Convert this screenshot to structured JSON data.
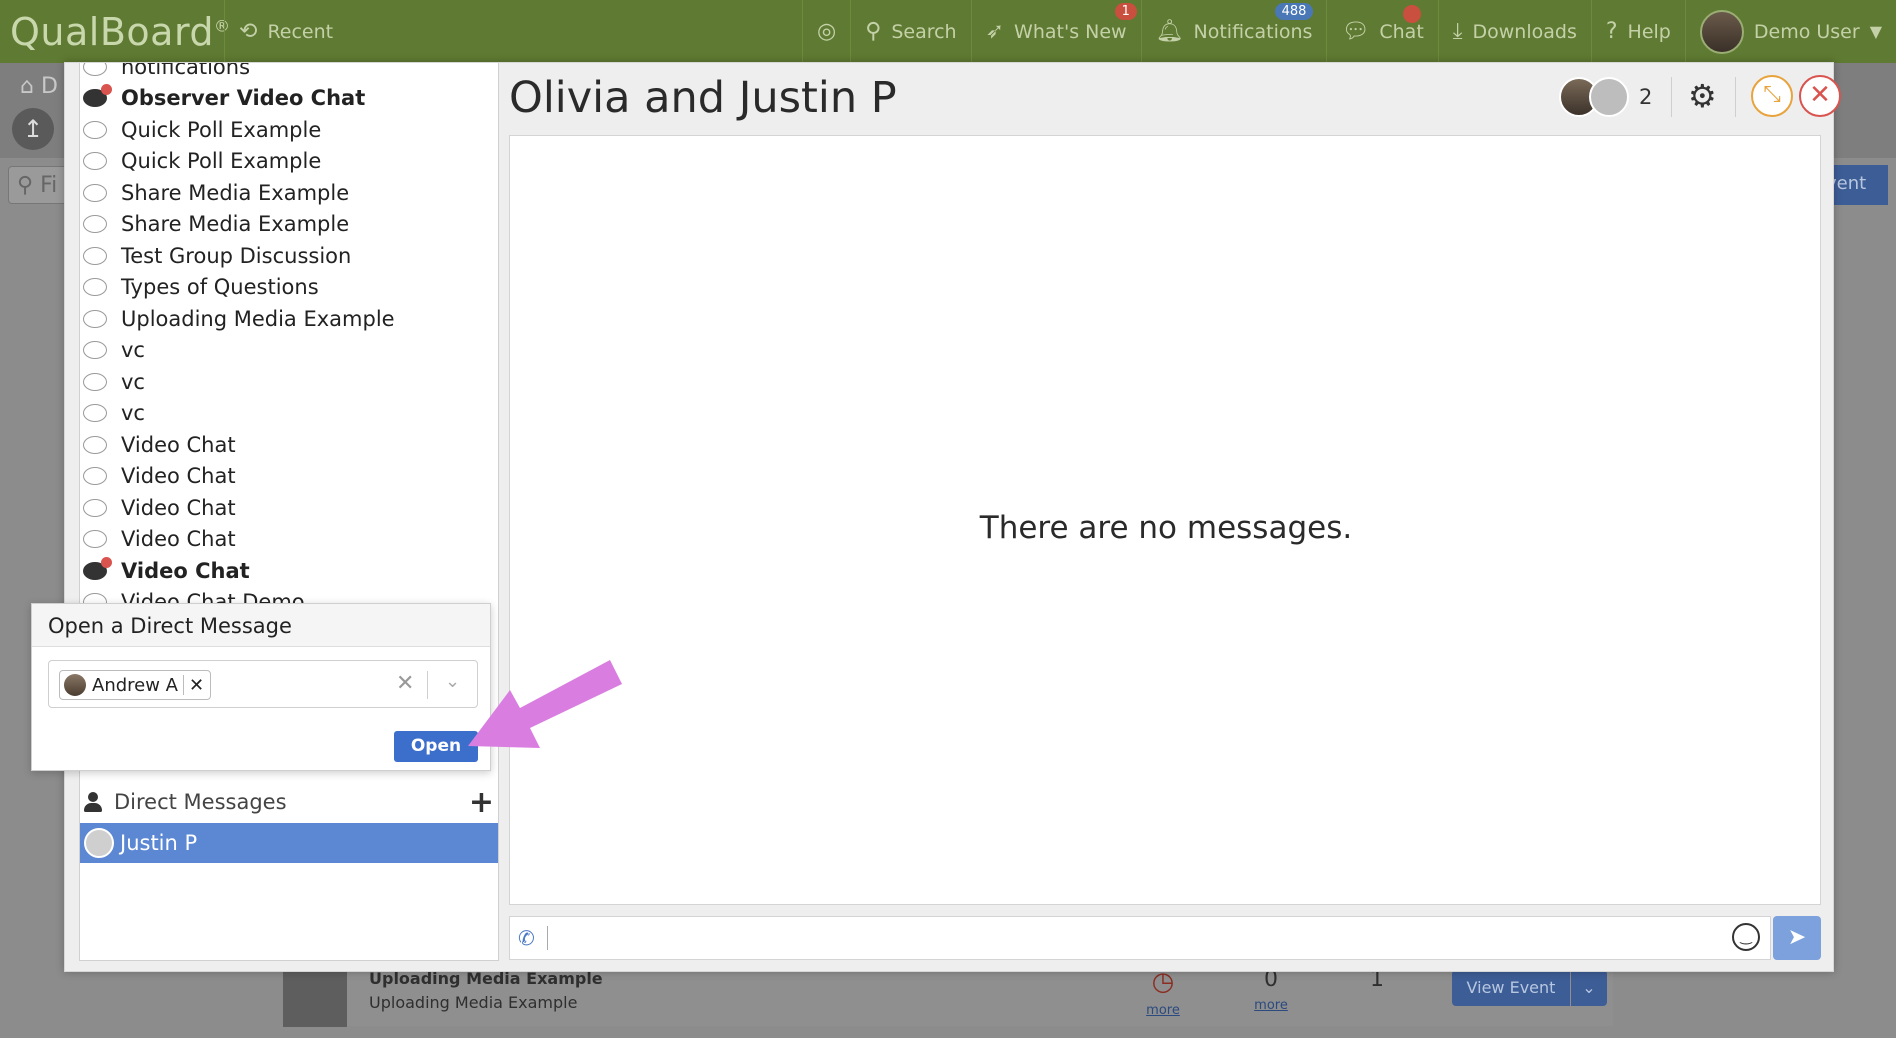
{
  "topbar": {
    "logo": "QualBoard",
    "logo_mark": "®",
    "recent": "Recent",
    "search": "Search",
    "whats_new": "What's New",
    "whats_new_badge": "1",
    "notifications": "Notifications",
    "notifications_badge": "488",
    "chat": "Chat",
    "downloads": "Downloads",
    "help": "Help",
    "user": "Demo User"
  },
  "background": {
    "home_crumb": "D",
    "filter_placeholder": "Fi",
    "event_button": "vent",
    "card_title": "Uploading Media Example",
    "card_subtitle": "Uploading Media Example",
    "stat1_link": "more",
    "stat2_value": "0",
    "stat2_link": "more",
    "stat3_value": "1",
    "view_event": "View Event"
  },
  "rooms": [
    {
      "label": "notifications",
      "bold": false,
      "unread": false
    },
    {
      "label": "Observer Video Chat",
      "bold": true,
      "unread": true
    },
    {
      "label": "Quick Poll Example",
      "bold": false,
      "unread": false
    },
    {
      "label": "Quick Poll Example",
      "bold": false,
      "unread": false
    },
    {
      "label": "Share Media Example",
      "bold": false,
      "unread": false
    },
    {
      "label": "Share Media Example",
      "bold": false,
      "unread": false
    },
    {
      "label": "Test Group Discussion",
      "bold": false,
      "unread": false
    },
    {
      "label": "Types of Questions",
      "bold": false,
      "unread": false
    },
    {
      "label": "Uploading Media Example",
      "bold": false,
      "unread": false
    },
    {
      "label": "vc",
      "bold": false,
      "unread": false
    },
    {
      "label": "vc",
      "bold": false,
      "unread": false
    },
    {
      "label": "vc",
      "bold": false,
      "unread": false
    },
    {
      "label": "Video Chat",
      "bold": false,
      "unread": false
    },
    {
      "label": "Video Chat",
      "bold": false,
      "unread": false
    },
    {
      "label": "Video Chat",
      "bold": false,
      "unread": false
    },
    {
      "label": "Video Chat",
      "bold": false,
      "unread": false
    },
    {
      "label": "Video Chat",
      "bold": true,
      "unread": true
    },
    {
      "label": "Video Chat Demo",
      "bold": false,
      "unread": false
    }
  ],
  "direct_messages": {
    "header": "Direct Messages",
    "items": [
      {
        "name": "Justin P",
        "selected": true
      }
    ]
  },
  "chat": {
    "title": "Olivia and Justin P",
    "participant_count": "2",
    "empty_text": "There are no messages."
  },
  "dm_popup": {
    "title": "Open a Direct Message",
    "selected_user": "Andrew A",
    "open_button": "Open"
  },
  "colors": {
    "topbar": "#5f7a32",
    "selected_dm": "#5b87d3",
    "primary_button": "#3c6fcc",
    "annotation_arrow": "#d97ee0"
  }
}
